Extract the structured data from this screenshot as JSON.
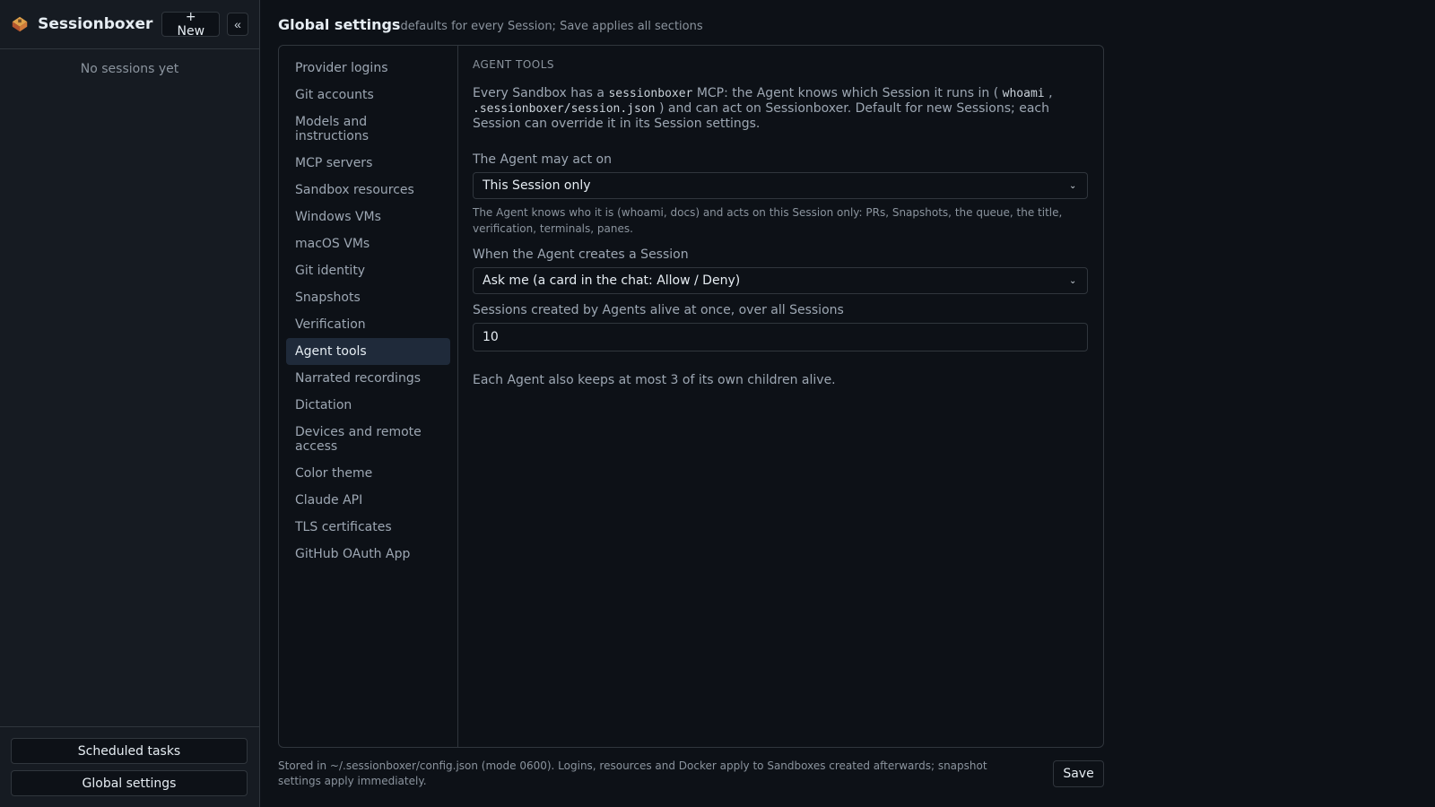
{
  "app": {
    "title": "Sessionboxer",
    "new_label": "+ New",
    "collapse_label": "«",
    "empty_sessions": "No sessions yet",
    "scheduled_tasks_label": "Scheduled tasks",
    "global_settings_label": "Global settings"
  },
  "header": {
    "title": "Global settings",
    "subtitle": "defaults for every Session; Save applies all sections"
  },
  "nav": {
    "items": [
      {
        "label": "Provider logins"
      },
      {
        "label": "Git accounts"
      },
      {
        "label": "Models and instructions"
      },
      {
        "label": "MCP servers"
      },
      {
        "label": "Sandbox resources"
      },
      {
        "label": "Windows VMs"
      },
      {
        "label": "macOS VMs"
      },
      {
        "label": "Git identity"
      },
      {
        "label": "Snapshots"
      },
      {
        "label": "Verification"
      },
      {
        "label": "Agent tools",
        "active": true
      },
      {
        "label": "Narrated recordings"
      },
      {
        "label": "Dictation"
      },
      {
        "label": "Devices and remote access"
      },
      {
        "label": "Color theme"
      },
      {
        "label": "Claude API"
      },
      {
        "label": "TLS certificates"
      },
      {
        "label": "GitHub OAuth App"
      }
    ]
  },
  "content": {
    "section_title": "AGENT TOOLS",
    "intro_1": "Every Sandbox has a ",
    "intro_mono_1": "sessionboxer",
    "intro_2": " MCP: the Agent knows which Session it runs in ( ",
    "intro_mono_2": "whoami",
    "intro_3": " ,",
    "intro_mono_3": " .sessionboxer/session.json",
    "intro_4": " ) and can act on Sessionboxer. Default for new Sessions; each Session can override it in its Session settings.",
    "act_on_label": "The Agent may act on",
    "act_on_value": "This Session only",
    "act_on_help": "The Agent knows who it is (whoami, docs) and acts on this Session only: PRs, Snapshots, the queue, the title, verification, terminals, panes.",
    "creates_label": "When the Agent creates a Session",
    "creates_value": "Ask me (a card in the chat: Allow / Deny)",
    "alive_label": "Sessions created by Agents alive at once, over all Sessions",
    "alive_value": "10",
    "children_note": "Each Agent also keeps at most 3 of its own children alive."
  },
  "footer": {
    "text": "Stored in ~/.sessionboxer/config.json (mode 0600). Logins, resources and Docker apply to Sandboxes created afterwards; snapshot settings apply immediately.",
    "save_label": "Save"
  }
}
